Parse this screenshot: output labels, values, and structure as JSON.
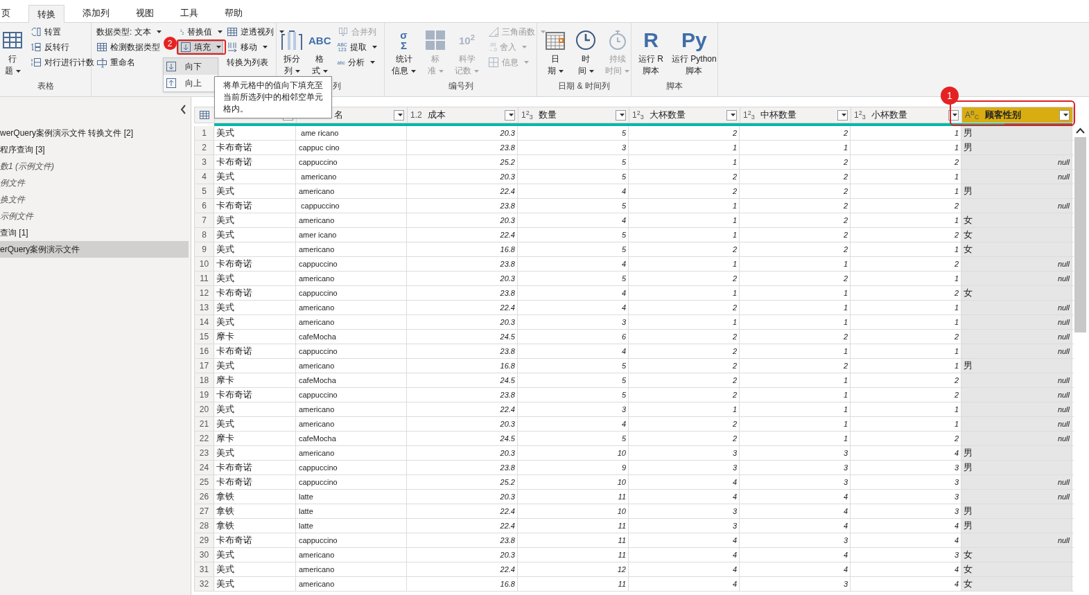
{
  "tabs": [
    {
      "label": "页",
      "selected": false
    },
    {
      "label": "转换",
      "selected": true
    },
    {
      "label": "添加列",
      "selected": false
    },
    {
      "label": "视图",
      "selected": false
    },
    {
      "label": "工具",
      "selected": false
    },
    {
      "label": "帮助",
      "selected": false
    }
  ],
  "ribbon": {
    "groups": [
      {
        "label": "表格",
        "columns": [
          [
            {
              "kind": "large",
              "lines": [
                "行",
                "题"
              ],
              "dropdown": true,
              "disabled": false
            }
          ],
          [
            {
              "kind": "small",
              "label": "转置",
              "disabled": false
            },
            {
              "kind": "small",
              "label": "反转行",
              "disabled": false
            },
            {
              "kind": "small",
              "label": "对行进行计数",
              "disabled": false
            }
          ]
        ]
      },
      {
        "columns": [
          [
            {
              "kind": "small",
              "label": "数据类型: 文本",
              "dropdown": true,
              "disabled": false
            },
            {
              "kind": "small",
              "label": "检测数据类型",
              "disabled": false
            },
            {
              "kind": "small",
              "label": "重命名",
              "disabled": false
            }
          ],
          [
            {
              "kind": "small",
              "label": "替换值",
              "icon_text": "$^{1}$$_{2}$",
              "dropdown": true,
              "disabled": false
            },
            {
              "kind": "small",
              "label": "填充",
              "dropdown": true,
              "disabled": false,
              "pressed": true,
              "callout": "2"
            }
          ],
          [
            {
              "kind": "small",
              "label": "逆透视列",
              "dropdown": true,
              "disabled": false
            },
            {
              "kind": "small",
              "label": "移动",
              "dropdown": true,
              "disabled": false
            },
            {
              "kind": "small",
              "label": "转换为列表",
              "disabled": false
            }
          ]
        ]
      },
      {
        "label": "列",
        "columns": [
          [
            {
              "kind": "large",
              "lines": [
                "拆分",
                "列"
              ],
              "dropdown": true,
              "disabled": false
            }
          ],
          [
            {
              "kind": "large",
              "lines": [
                "格",
                "式"
              ],
              "icon_text": "ABC",
              "dropdown": true,
              "disabled": false
            }
          ],
          [
            {
              "kind": "small",
              "label": "合并列",
              "disabled": true
            },
            {
              "kind": "small",
              "label": "提取",
              "icon_text": "ABC\n123",
              "dropdown": true,
              "disabled": false
            },
            {
              "kind": "small",
              "label": "分析",
              "icon_text": "abc",
              "dropdown": true,
              "disabled": false
            }
          ]
        ]
      },
      {
        "label": "编号列",
        "columns": [
          [
            {
              "kind": "large",
              "lines": [
                "统计",
                "信息"
              ],
              "icon_text": "σ\nΣ",
              "dropdown": true,
              "disabled": false
            }
          ],
          [
            {
              "kind": "large",
              "lines": [
                "标",
                "准"
              ],
              "dropdown": true,
              "disabled": true
            }
          ],
          [
            {
              "kind": "large",
              "lines": [
                "科学",
                "记数"
              ],
              "icon_text": "10$^{2}$",
              "dropdown": true,
              "disabled": true
            }
          ],
          [
            {
              "kind": "small",
              "label": "三角函数",
              "dropdown": true,
              "disabled": true
            },
            {
              "kind": "small",
              "label": "舍入",
              "icon_text": ".00\n→.0",
              "dropdown": true,
              "disabled": true
            },
            {
              "kind": "small",
              "label": "信息",
              "dropdown": true,
              "disabled": true
            }
          ]
        ]
      },
      {
        "label": "日期 & 时间列",
        "columns": [
          [
            {
              "kind": "large",
              "lines": [
                "日",
                "期"
              ],
              "dropdown": true,
              "disabled": false
            }
          ],
          [
            {
              "kind": "large",
              "lines": [
                "时",
                "间"
              ],
              "dropdown": true,
              "disabled": false
            }
          ],
          [
            {
              "kind": "large",
              "lines": [
                "持续",
                "时间"
              ],
              "dropdown": true,
              "disabled": true
            }
          ]
        ]
      },
      {
        "label": "脚本",
        "columns": [
          [
            {
              "kind": "large",
              "lines": [
                "运行 R",
                "脚本"
              ],
              "icon_text": "R",
              "disabled": false
            }
          ],
          [
            {
              "kind": "large",
              "lines": [
                "运行 Python",
                "脚本"
              ],
              "icon_text": "Py",
              "disabled": false
            }
          ]
        ]
      }
    ]
  },
  "fill_menu": {
    "items": [
      {
        "label": "向下",
        "selected": true
      },
      {
        "label": "向上",
        "selected": false
      }
    ]
  },
  "tooltip": "将单元格中的值向下填充至当前所选列中的相邻空单元格内。",
  "queries": [
    {
      "label": "werQuery案例演示文件 转换文件 [2]",
      "italic": false,
      "selected": false
    },
    {
      "label": "程序查询 [3]",
      "italic": false,
      "selected": false
    },
    {
      "label": "数1 (示例文件)",
      "italic": true,
      "selected": false
    },
    {
      "label": "例文件",
      "italic": true,
      "selected": false
    },
    {
      "label": "换文件",
      "italic": true,
      "selected": false
    },
    {
      "label": "示例文件",
      "italic": true,
      "selected": false
    },
    {
      "label": "查询 [1]",
      "italic": false,
      "selected": false
    },
    {
      "label": "erQuery案例演示文件",
      "italic": false,
      "selected": true
    }
  ],
  "table": {
    "columns": [
      {
        "numeric": false,
        "selected": false,
        "level": 1
      },
      {
        "label": "名",
        "numeric": false,
        "selected": false,
        "level": 1
      },
      {
        "type_label": "1.2",
        "label": "成本",
        "numeric": true,
        "selected": false,
        "level": 1
      },
      {
        "type_label": "1$^{2}$$_{3}$",
        "label": "数量",
        "numeric": true,
        "selected": false,
        "level": 1
      },
      {
        "type_label": "1$^{2}$$_{3}$",
        "label": "大杯数量",
        "numeric": true,
        "selected": false,
        "level": 1
      },
      {
        "type_label": "1$^{2}$$_{3}$",
        "label": "中杯数量",
        "numeric": true,
        "selected": false,
        "level": 1
      },
      {
        "type_label": "1$^{2}$$_{3}$",
        "label": "小杯数量",
        "numeric": true,
        "selected": false,
        "level": 1
      },
      {
        "type_label": "A$^{B}$$_{C}$",
        "label": "顾客性别",
        "numeric": false,
        "selected": true,
        "level": 0.39,
        "callout": "1"
      }
    ],
    "rows": [
      {
        "n": "1",
        "cells": [
          "美式",
          " ame ricano",
          "20.3",
          "5",
          "2",
          "2",
          "1",
          "男"
        ],
        "null_last": false
      },
      {
        "n": "2",
        "cells": [
          "卡布奇诺",
          "cappuc cino",
          "23.8",
          "3",
          "1",
          "1",
          "1",
          "男"
        ],
        "null_last": false
      },
      {
        "n": "3",
        "cells": [
          "卡布奇诺",
          "cappuccino",
          "25.2",
          "5",
          "1",
          "2",
          "2",
          "null"
        ],
        "null_last": true
      },
      {
        "n": "4",
        "cells": [
          "美式",
          " americano",
          "20.3",
          "5",
          "2",
          "2",
          "1",
          "null"
        ],
        "null_last": true
      },
      {
        "n": "5",
        "cells": [
          "美式",
          "americano",
          "22.4",
          "4",
          "2",
          "2",
          "1",
          "男"
        ],
        "null_last": false
      },
      {
        "n": "6",
        "cells": [
          "卡布奇诺",
          " cappuccino",
          "23.8",
          "5",
          "1",
          "2",
          "2",
          "null"
        ],
        "null_last": true
      },
      {
        "n": "7",
        "cells": [
          "美式",
          "americano",
          "20.3",
          "4",
          "1",
          "2",
          "1",
          "女"
        ],
        "null_last": false
      },
      {
        "n": "8",
        "cells": [
          "美式",
          "amer icano",
          "22.4",
          "5",
          "1",
          "2",
          "2",
          "女"
        ],
        "null_last": false
      },
      {
        "n": "9",
        "cells": [
          "美式",
          "americano",
          "16.8",
          "5",
          "2",
          "2",
          "1",
          "女"
        ],
        "null_last": false
      },
      {
        "n": "10",
        "cells": [
          "卡布奇诺",
          "cappuccino",
          "23.8",
          "4",
          "1",
          "1",
          "2",
          "null"
        ],
        "null_last": true
      },
      {
        "n": "11",
        "cells": [
          "美式",
          "americano",
          "20.3",
          "5",
          "2",
          "2",
          "1",
          "null"
        ],
        "null_last": true
      },
      {
        "n": "12",
        "cells": [
          "卡布奇诺",
          "cappuccino",
          "23.8",
          "4",
          "1",
          "1",
          "2",
          "女"
        ],
        "null_last": false
      },
      {
        "n": "13",
        "cells": [
          "美式",
          "americano",
          "22.4",
          "4",
          "2",
          "1",
          "1",
          "null"
        ],
        "null_last": true
      },
      {
        "n": "14",
        "cells": [
          "美式",
          "americano",
          "20.3",
          "3",
          "1",
          "1",
          "1",
          "null"
        ],
        "null_last": true
      },
      {
        "n": "15",
        "cells": [
          "摩卡",
          "cafeMocha",
          "24.5",
          "6",
          "2",
          "2",
          "2",
          "null"
        ],
        "null_last": true
      },
      {
        "n": "16",
        "cells": [
          "卡布奇诺",
          "cappuccino",
          "23.8",
          "4",
          "2",
          "1",
          "1",
          "null"
        ],
        "null_last": true
      },
      {
        "n": "17",
        "cells": [
          "美式",
          "americano",
          "16.8",
          "5",
          "2",
          "2",
          "1",
          "男"
        ],
        "null_last": false
      },
      {
        "n": "18",
        "cells": [
          "摩卡",
          "cafeMocha",
          "24.5",
          "5",
          "2",
          "1",
          "2",
          "null"
        ],
        "null_last": true
      },
      {
        "n": "19",
        "cells": [
          "卡布奇诺",
          "cappuccino",
          "23.8",
          "5",
          "2",
          "1",
          "2",
          "null"
        ],
        "null_last": true
      },
      {
        "n": "20",
        "cells": [
          "美式",
          "americano",
          "22.4",
          "3",
          "1",
          "1",
          "1",
          "null"
        ],
        "null_last": true
      },
      {
        "n": "21",
        "cells": [
          "美式",
          "americano",
          "20.3",
          "4",
          "2",
          "1",
          "1",
          "null"
        ],
        "null_last": true
      },
      {
        "n": "22",
        "cells": [
          "摩卡",
          "cafeMocha",
          "24.5",
          "5",
          "2",
          "1",
          "2",
          "null"
        ],
        "null_last": true
      },
      {
        "n": "23",
        "cells": [
          "美式",
          "americano",
          "20.3",
          "10",
          "3",
          "3",
          "4",
          "男"
        ],
        "null_last": false
      },
      {
        "n": "24",
        "cells": [
          "卡布奇诺",
          "cappuccino",
          "23.8",
          "9",
          "3",
          "3",
          "3",
          "男"
        ],
        "null_last": false
      },
      {
        "n": "25",
        "cells": [
          "卡布奇诺",
          "cappuccino",
          "25.2",
          "10",
          "4",
          "3",
          "3",
          "null"
        ],
        "null_last": true
      },
      {
        "n": "26",
        "cells": [
          "拿铁",
          "latte",
          "20.3",
          "11",
          "4",
          "4",
          "3",
          "null"
        ],
        "null_last": true
      },
      {
        "n": "27",
        "cells": [
          "拿铁",
          "latte",
          "22.4",
          "10",
          "3",
          "4",
          "3",
          "男"
        ],
        "null_last": false
      },
      {
        "n": "28",
        "cells": [
          "拿铁",
          "latte",
          "22.4",
          "11",
          "3",
          "4",
          "4",
          "男"
        ],
        "null_last": false
      },
      {
        "n": "29",
        "cells": [
          "卡布奇诺",
          "cappuccino",
          "23.8",
          "11",
          "4",
          "3",
          "4",
          "null"
        ],
        "null_last": true
      },
      {
        "n": "30",
        "cells": [
          "美式",
          "americano",
          "20.3",
          "11",
          "4",
          "4",
          "3",
          "女"
        ],
        "null_last": false
      },
      {
        "n": "31",
        "cells": [
          "美式",
          "americano",
          "22.4",
          "12",
          "4",
          "4",
          "4",
          "女"
        ],
        "null_last": false
      },
      {
        "n": "32",
        "cells": [
          "美式",
          "americano",
          "16.8",
          "11",
          "4",
          "3",
          "4",
          "女"
        ],
        "null_last": false
      }
    ]
  }
}
